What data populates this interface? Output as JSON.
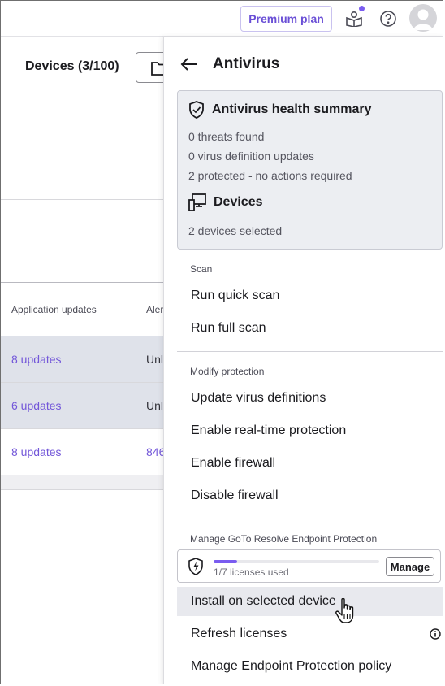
{
  "topbar": {
    "premium_label": "Premium plan",
    "icons": [
      "book-icon",
      "help-icon",
      "avatar"
    ],
    "accent_color": "#7a5cf0"
  },
  "background_page": {
    "title": "Devices (3/100)",
    "columns": [
      "Application updates",
      "Aler"
    ],
    "rows": [
      {
        "updates": "8 updates",
        "col2": "Unl",
        "selected": true
      },
      {
        "updates": "6 updates",
        "col2": "Unl",
        "selected": true
      },
      {
        "updates": "8 updates",
        "col2": "846",
        "selected": false
      }
    ]
  },
  "drawer": {
    "title": "Antivirus",
    "summary": {
      "heading": "Antivirus health summary",
      "lines": [
        "0 threats found",
        "0 virus definition updates",
        "2 protected - no actions required"
      ],
      "devices_heading": "Devices",
      "devices_line": "2 devices selected"
    },
    "scan": {
      "label": "Scan",
      "items": [
        "Run quick scan",
        "Run full scan"
      ]
    },
    "modify": {
      "label": "Modify protection",
      "items": [
        "Update virus definitions",
        "Enable real-time protection",
        "Enable firewall",
        "Disable firewall"
      ]
    },
    "manage": {
      "label": "Manage GoTo Resolve Endpoint Protection",
      "licenses_used": 1,
      "licenses_total": 7,
      "license_text": "1/7 licenses used",
      "manage_button": "Manage",
      "items": [
        "Install on selected device",
        "Refresh licenses",
        "Manage Endpoint Protection policy"
      ]
    }
  }
}
